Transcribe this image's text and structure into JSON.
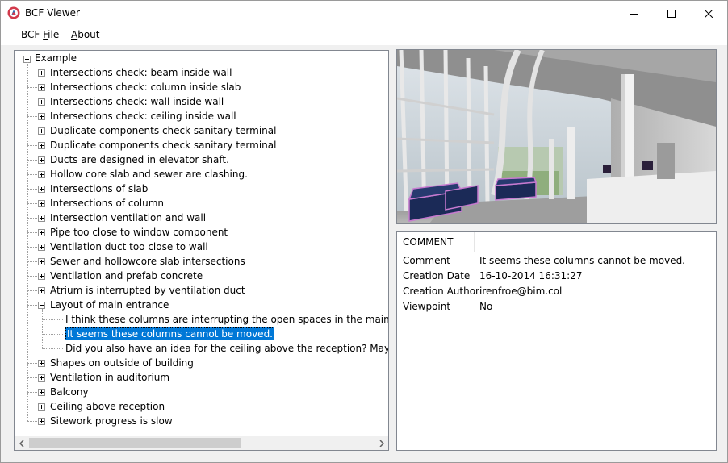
{
  "window": {
    "title": "BCF Viewer"
  },
  "menu": {
    "items": [
      {
        "pre": "BCF ",
        "ul": "F",
        "post": "ile"
      },
      {
        "pre": "",
        "ul": "A",
        "post": "bout"
      }
    ]
  },
  "tree": {
    "root": "Example",
    "topics": [
      "Intersections check: beam inside wall",
      "Intersections check: column inside slab",
      "Intersections check: wall inside wall",
      "Intersections check: ceiling inside wall",
      "Duplicate components check sanitary terminal",
      "Duplicate components check sanitary terminal",
      "Ducts are designed in elevator shaft.",
      "Hollow core slab and sewer are clashing.",
      "Intersections of slab",
      "Intersections of column",
      "Intersection ventilation and wall",
      "Pipe too close to window component",
      "Ventilation duct too close to wall",
      "Sewer and hollowcore slab intersections",
      "Ventilation and prefab concrete",
      "Atrium is interrupted by ventilation duct",
      "Layout of main entrance",
      "Shapes on outside of building",
      "Ventilation in auditorium",
      "Balcony",
      "Ceiling above reception",
      "Sitework progress is slow"
    ],
    "expanded_comments": [
      "I think these columns are interrupting the open spaces in the main entrance",
      "It seems these columns cannot be moved.",
      "Did you also have an idea for the ceiling above the reception? Maybe we can"
    ],
    "selected_comment": "It seems these columns cannot be moved."
  },
  "details": {
    "header": "COMMENT",
    "rows": [
      {
        "key": "Comment",
        "value": "It seems these columns cannot be moved."
      },
      {
        "key": "Creation Date",
        "value": "16-10-2014 16:31:27"
      },
      {
        "key": "Creation Author",
        "value": "irenfroe@bim.col"
      },
      {
        "key": "Viewpoint",
        "value": "No"
      }
    ]
  },
  "colors": {
    "selection": "#0078d7",
    "sofa": "#1b2a57",
    "sofa_outline": "#c77ad0"
  }
}
